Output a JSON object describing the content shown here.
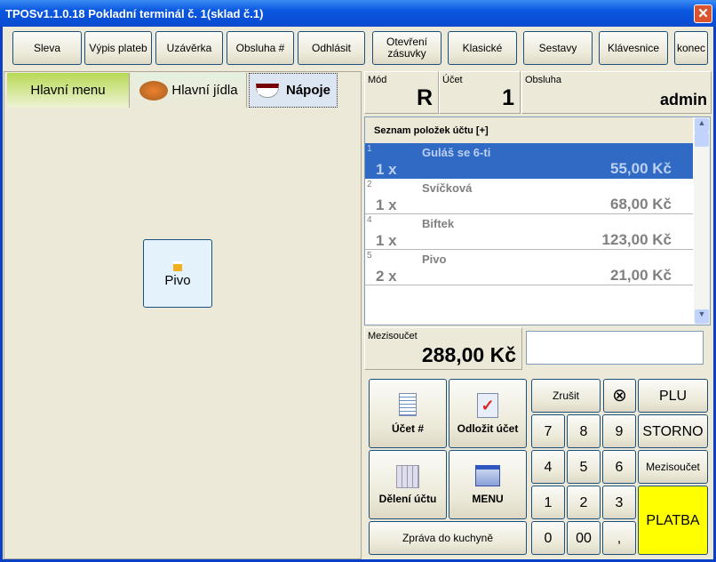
{
  "window": {
    "title": "TPOSv1.1.0.18 Pokladní terminál č. 1(sklad č.1)",
    "close": "✕"
  },
  "toolbar": [
    "Sleva",
    "Výpis plateb",
    "Uzávěrka",
    "Obsluha #",
    "Odhlásit",
    "Otevření zásuvky",
    "Klasické",
    "Sestavy",
    "Klávesnice",
    "konec"
  ],
  "tabs": [
    {
      "label": "Hlavní menu"
    },
    {
      "label": "Hlavní jídla"
    },
    {
      "label": "Nápoje"
    }
  ],
  "products": [
    {
      "label": "Pivo"
    }
  ],
  "info": {
    "mode_label": "Mód",
    "mode": "R",
    "account_label": "Účet",
    "account": "1",
    "staff_label": "Obsluha",
    "staff": "admin"
  },
  "list": {
    "header": "Seznam položek účtu [+]",
    "items": [
      {
        "no": "1",
        "name": "Guláš se 6-ti",
        "qty": "1 x",
        "price": "55,00 Kč"
      },
      {
        "no": "2",
        "name": "Svíčková",
        "qty": "1 x",
        "price": "68,00 Kč"
      },
      {
        "no": "4",
        "name": "Biftek",
        "qty": "1 x",
        "price": "123,00 Kč"
      },
      {
        "no": "5",
        "name": "Pivo",
        "qty": "2 x",
        "price": "21,00 Kč"
      }
    ]
  },
  "subtotal": {
    "label": "Mezisoučet",
    "value": "288,00 Kč",
    "input": ""
  },
  "actions": {
    "account": "Účet #",
    "postpone": "Odložit účet",
    "split": "Dělení účtu",
    "menu": "MENU",
    "kitchen": "Zpráva do kuchyně"
  },
  "keypad": {
    "cancel": "Zrušit",
    "clear": "⊗",
    "plu": "PLU",
    "storno": "STORNO",
    "subtotal": "Mezisoučet",
    "pay": "PLATBA",
    "keys": [
      "7",
      "8",
      "9",
      "4",
      "5",
      "6",
      "1",
      "2",
      "3",
      "0",
      "00",
      ","
    ]
  },
  "colors": {
    "selected": "#316ac5",
    "pay": "#ffff00",
    "tab_active": "#b7d955"
  }
}
